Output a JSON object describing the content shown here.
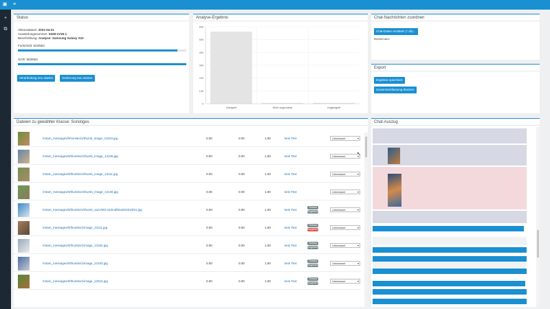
{
  "colors": {
    "accent": "#1a8fd1",
    "sidebar": "#1c2833",
    "bar": "#e6e6e6",
    "danger": "#d9534f",
    "tag_grey": "#7b8a8b"
  },
  "topbar": {
    "icons": [
      "window-icon",
      "menu-icon"
    ]
  },
  "sidebar": {
    "items": [
      {
        "icon": "plus-icon",
        "glyph": "+"
      },
      {
        "icon": "copy-icon",
        "glyph": "⧉"
      }
    ]
  },
  "status": {
    "title": "Status",
    "date_label": "Aktionsdatum:",
    "date_value": "2021-04-21",
    "job_label": "Auswertungsnummer:",
    "job_value": "5328-1V35-1",
    "desc_label": "Beschreibung:",
    "desc_value": "Analyse: Samsung Galaxy S10",
    "progress_label": "Fortschritt: 523/553",
    "progress_pct": 94.6,
    "ocr_label": "OCR: 553/553",
    "ocr_pct": 100,
    "btn_prev": "Verarbeitung neu starten",
    "btn_next": "Sortierung neu starten"
  },
  "chart_data": {
    "type": "bar",
    "title": "Analyse-Ergebnis",
    "categories": [
      "Geeignet",
      "Nicht zugeordnet",
      "Ungeeignet"
    ],
    "values": [
      560,
      3,
      5
    ],
    "ylim": [
      0,
      600
    ],
    "yticks": [
      "600",
      "500",
      "400",
      "300",
      "200",
      "100",
      "0"
    ]
  },
  "chat_assign": {
    "title": "Chat-Nachrichten zuordnen",
    "btn": "Chat-Daten ermitteln (*.db)...",
    "status": "Bereitet aber"
  },
  "export": {
    "title": "Export",
    "btn1": "Ergebnis speichern",
    "btn2": "Zusammenfassung drucken"
  },
  "list": {
    "title": "Dateien zu gewählter Klasse: Sonstiges",
    "rows": [
      {
        "file": "/mtam_messages/0/sonstio/1/thumb_image_13104.jpg",
        "a": "0.00",
        "b": "0.00",
        "c": "1.00",
        "link": "kein Text",
        "tags": [],
        "select": "Unbekannt",
        "thumb": [
          "#6b8f3a",
          "#c28a63"
        ]
      },
      {
        "file": "/mtam_messages/0/thumbs/1/thumb_image_13106.jpg",
        "a": "0.00",
        "b": "0.00",
        "c": "1.00",
        "link": "kein Text",
        "tags": [],
        "select": "Unbekannt",
        "thumb": [
          "#5f86a8",
          "#d3b08a"
        ]
      },
      {
        "file": "/mtam_messages/0/thumbs/1/thumb_image_13111.jpg",
        "a": "0.00",
        "b": "0.00",
        "c": "1.00",
        "link": "kein Text",
        "tags": [],
        "select": "Unbekannt",
        "thumb": [
          "#7a8f52",
          "#a88a6a"
        ]
      },
      {
        "file": "/mtam_messages/0/thumbs/1/thumb_image_13146.jpg",
        "a": "0.00",
        "b": "0.00",
        "c": "1.00",
        "link": "kein Text",
        "tags": [],
        "select": "Unbekannt",
        "thumb": [
          "#6d9a58",
          "#8a7a5a"
        ]
      },
      {
        "file": "/mtam_messages/0/thumbs/1/thumb_sazz/t93-410mdf84a002019/51.jpg",
        "a": "0.00",
        "b": "0.00",
        "c": "1.00",
        "link": "kein Text",
        "tags": [
          {
            "label": "Thessa",
            "color": "#7b8a8b"
          },
          {
            "label": "Eingehend",
            "color": "#7b8a8b"
          }
        ],
        "select": "Unbekannt",
        "thumb": [
          "#3e87c4",
          "#d7e4ee"
        ]
      },
      {
        "file": "/mtam_messages/0/thumbs/1/image_13111.jpg",
        "a": "0.00",
        "b": "0.00",
        "c": "1.00",
        "link": "kein Text",
        "tags": [
          {
            "label": "Thessa",
            "color": "#7b8a8b"
          },
          {
            "label": "Ausgehend",
            "color": "#d9534f"
          }
        ],
        "select": "Unbekannt",
        "thumb": [
          "#a67b5b",
          "#5a4a3a"
        ]
      },
      {
        "file": "/mtam_messages/0/thumbs/1/image_13192.jpg",
        "a": "0.00",
        "b": "0.00",
        "c": "1.00",
        "link": "kein Text",
        "tags": [
          {
            "label": "Thessa",
            "color": "#7b8a8b"
          },
          {
            "label": "Eingehend",
            "color": "#7b8a8b"
          }
        ],
        "select": "Unbekannt",
        "thumb": [
          "#9aa8b8",
          "#e8ecef"
        ]
      },
      {
        "file": "/mtam_messages/0/thumbs/1/image_13193.jpg",
        "a": "0.00",
        "b": "0.00",
        "c": "1.00",
        "link": "kein Text",
        "tags": [
          {
            "label": "Thessa",
            "color": "#7b8a8b"
          },
          {
            "label": "Eingehend",
            "color": "#7b8a8b"
          }
        ],
        "select": "Unbekannt",
        "thumb": [
          "#4a6fa5",
          "#c8c8d0"
        ]
      },
      {
        "file": "/mtam_messages/0/thumbs/1/image_13315.jpg",
        "a": "0.00",
        "b": "0.00",
        "c": "1.00",
        "link": "kein Text",
        "tags": [
          {
            "label": "Thessa",
            "color": "#7b8a8b"
          },
          {
            "label": "Ausgehend",
            "color": "#7b8a8b"
          }
        ],
        "select": "Unbekannt",
        "thumb": [
          "#4f8a3a",
          "#b06a3a"
        ]
      }
    ]
  },
  "chat_excerpt": {
    "title": "Chat-Auszug"
  }
}
